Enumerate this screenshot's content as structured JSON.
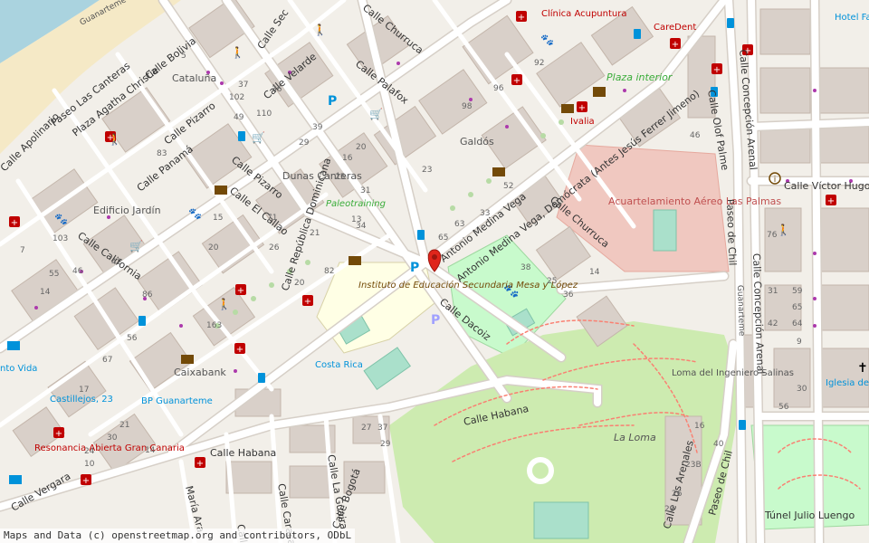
{
  "map": {
    "colors": {
      "background": "#f2efe9",
      "building": "#d9d0c9",
      "building_stroke": "#c4b6ab",
      "road": "#ffffff",
      "road_casing": "#d6cfc7",
      "sea": "#aad3df",
      "beach": "#f5e9c6",
      "park": "#c8facc",
      "grass": "#cdebb0",
      "military": "#f0c8c0",
      "school": "#ffffe5",
      "pitch": "#aae0cb",
      "poi_red": "#c00000",
      "poi_blue": "#0092da",
      "poi_brown": "#734a08",
      "poi_green": "#39ac39",
      "poi_purple": "#ac39ac",
      "poi_label_blue": "#0092da",
      "poi_label_red": "#c00000",
      "poi_label_brown": "#734a08",
      "poi_label_green": "#39ac39",
      "path_red": "#fa8072",
      "marker": "#e0251b"
    },
    "street_labels": [
      "Guanarteme",
      "Paseo Las Canteras",
      "Plaza Agatha Christie",
      "Calle Bolivia",
      "Calle Apolinario",
      "Calle Pizarro",
      "Calle Panamá",
      "Calle California",
      "Calle Vergara",
      "Calle Velarde",
      "Calle Churruca",
      "Calle Palafox",
      "Calle Pizarro",
      "Calle El Callao",
      "Calle República Dominicana",
      "Antonio Medina Vega",
      "Antonio Medina Vega, Demócrata (Antes Jesús Ferrer Jimeno)",
      "Calle Churruca",
      "Calle Dacoiz",
      "Calle Habana",
      "Calle Habana",
      "Calle Caracas",
      "Calle La Guaira",
      "Calle Bogotá",
      "María Ara",
      "Calle Olof Palme",
      "Calle Concepción Arenal",
      "Paseo de Chil",
      "Calle Concepción Arenal",
      "Calle Víctor Hugo",
      "Calle Los Arenales",
      "Paseo de Chil",
      "Túnel Julio Luengo",
      "Guanarteme",
      "Calle Sec",
      "Calle Pa"
    ],
    "place_labels": [
      "Cataluña",
      "Dunas Canteras",
      "Galdós",
      "Edificio Jardín",
      "Caixabank",
      "Plaza interior",
      "Acuartelamiento Aéreo Las Palmas",
      "Loma del Ingeniero Salinas",
      "La Loma"
    ],
    "poi_labels": [
      {
        "text": "Clínica Acupuntura",
        "color": "red"
      },
      {
        "text": "CareDent",
        "color": "red"
      },
      {
        "text": "Hotel Fa",
        "color": "blue"
      },
      {
        "text": "Ivalia",
        "color": "red"
      },
      {
        "text": "Paleotraining",
        "color": "green"
      },
      {
        "text": "Instituto de Educación Secundaria Mesa y López",
        "color": "brown"
      },
      {
        "text": "Costa Rica",
        "color": "blue"
      },
      {
        "text": "BP Guanarteme",
        "color": "blue"
      },
      {
        "text": "Castillejos, 23",
        "color": "blue"
      },
      {
        "text": "Resonancia Abierta Gran Canaria",
        "color": "red"
      },
      {
        "text": "Iglesia de pentec",
        "color": "blue"
      },
      {
        "text": "nto Vida",
        "color": "blue"
      }
    ],
    "house_numbers": [
      "92",
      "96",
      "98",
      "5",
      "37",
      "102",
      "110",
      "49",
      "36",
      "39",
      "29",
      "16",
      "25",
      "31",
      "20",
      "83",
      "103",
      "55",
      "42",
      "46",
      "21",
      "13",
      "20",
      "15",
      "34",
      "20",
      "26",
      "82",
      "71",
      "86",
      "163",
      "56",
      "67",
      "17",
      "14",
      "21",
      "30",
      "24",
      "10",
      "65",
      "63",
      "52",
      "33",
      "36",
      "25",
      "38",
      "14",
      "46",
      "37",
      "27",
      "29",
      "23",
      "76",
      "59",
      "65",
      "64",
      "56",
      "9",
      "30",
      "31",
      "42",
      "16",
      "40",
      "23B",
      "26",
      "20",
      "14",
      "7",
      "9"
    ],
    "attribution": "Maps and Data (c) openstreetmap.org and contributors, ODbL"
  }
}
